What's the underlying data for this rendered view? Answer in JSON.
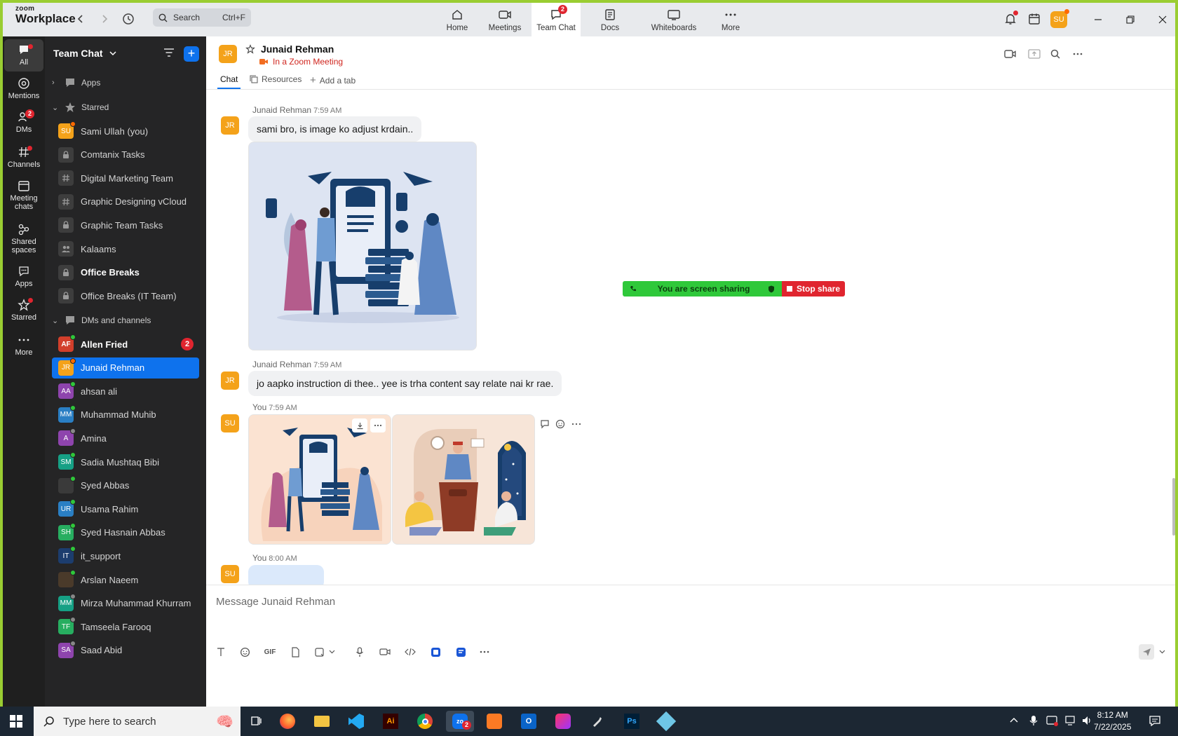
{
  "app": {
    "logo_small": "zoom",
    "logo_big": "Workplace",
    "search_placeholder": "Search",
    "search_shortcut": "Ctrl+F",
    "nav_tabs": [
      {
        "label": "Home"
      },
      {
        "label": "Meetings"
      },
      {
        "label": "Team Chat",
        "badge": "2"
      },
      {
        "label": "Docs"
      },
      {
        "label": "Whiteboards"
      },
      {
        "label": "More"
      }
    ],
    "user_initials": "SU"
  },
  "rail": {
    "items": [
      {
        "label": "All"
      },
      {
        "label": "Mentions"
      },
      {
        "label": "DMs",
        "badge": "2"
      },
      {
        "label": "Channels"
      },
      {
        "label": "Meeting chats"
      },
      {
        "label": "Shared spaces"
      },
      {
        "label": "Apps"
      },
      {
        "label": "Starred"
      },
      {
        "label": "More"
      }
    ]
  },
  "sidebar": {
    "title": "Team Chat",
    "apps_label": "Apps",
    "starred_label": "Starred",
    "dms_label": "DMs and channels",
    "starred": [
      {
        "name": "Sami Ullah (you)",
        "initials": "SU",
        "color": "#f4a21a",
        "status": "#ff6a00"
      },
      {
        "name": "Comtanix Tasks",
        "icon": "lock-icon"
      },
      {
        "name": "Digital Marketing Team",
        "icon": "hash-icon"
      },
      {
        "name": "Graphic Designing vCloud",
        "icon": "hash-icon"
      },
      {
        "name": "Graphic Team Tasks",
        "icon": "lock-icon"
      },
      {
        "name": "Kalaams",
        "icon": "group-icon"
      },
      {
        "name": "Office Breaks",
        "icon": "lock-icon",
        "bold": true
      },
      {
        "name": "Office Breaks (IT Team)",
        "icon": "lock-icon"
      }
    ],
    "dms": [
      {
        "name": "Allen Fried",
        "initials": "AF",
        "color": "#d23f2b",
        "status": "#2fc83a",
        "bold": true,
        "unread": "2"
      },
      {
        "name": "Junaid Rehman",
        "initials": "JR",
        "color": "#f4a21a",
        "status": "#ff6a00",
        "selected": true
      },
      {
        "name": "ahsan ali",
        "initials": "AA",
        "color": "#8e44ad",
        "status": "#2fc83a"
      },
      {
        "name": "Muhammad Muhib",
        "initials": "MM",
        "color": "#2a7fc4",
        "status": "#2fc83a"
      },
      {
        "name": "Amina",
        "initials": "A",
        "color": "#8e44ad",
        "status": "#888888"
      },
      {
        "name": "Sadia Mushtaq Bibi",
        "initials": "SM",
        "color": "#16a085",
        "status": "#2fc83a"
      },
      {
        "name": "Syed Abbas",
        "initials": "",
        "color": "#3a3a3a",
        "status": "#2fc83a"
      },
      {
        "name": "Usama Rahim",
        "initials": "UR",
        "color": "#2a7fc4",
        "status": "#2fc83a"
      },
      {
        "name": "Syed Hasnain Abbas",
        "initials": "SH",
        "color": "#27ae60",
        "status": "#2fc83a"
      },
      {
        "name": "it_support",
        "initials": "IT",
        "color": "#1c3d6e",
        "status": "#2fc83a"
      },
      {
        "name": "Arslan Naeem",
        "initials": "",
        "color": "#4a3a2a",
        "status": "#2fc83a"
      },
      {
        "name": "Mirza Muhammad Khurram",
        "initials": "MM",
        "color": "#16a085",
        "status": "#888888"
      },
      {
        "name": "Tamseela Farooq",
        "initials": "TF",
        "color": "#27ae60",
        "status": "#888888"
      },
      {
        "name": "Saad Abid",
        "initials": "SA",
        "color": "#8e44ad",
        "status": "#888888"
      }
    ]
  },
  "chat": {
    "name": "Junaid Rehman",
    "initials": "JR",
    "status": "In a Zoom Meeting",
    "tabs": [
      {
        "label": "Chat"
      },
      {
        "label": "Resources"
      },
      {
        "label": "Add a tab"
      }
    ],
    "messages": [
      {
        "sender": "Junaid Rehman",
        "time": "7:59 AM",
        "text": "sami bro, is image ko adjust krdain.."
      },
      {
        "sender": "Junaid Rehman",
        "time": "7:59 AM",
        "text": "jo aapko instruction di thee.. yee is trha content say relate nai kr rae."
      },
      {
        "sender": "You",
        "time": "7:59 AM"
      },
      {
        "sender": "You",
        "time": "8:00 AM"
      }
    ],
    "self_initials": "SU",
    "screen_share_text": "You are screen sharing",
    "stop_share_label": "Stop share",
    "composer_placeholder": "Message Junaid Rehman"
  },
  "taskbar": {
    "search_placeholder": "Type here to search",
    "time": "8:12 AM",
    "date": "7/22/2025",
    "zoom_badge": "2"
  },
  "colors": {
    "accent": "#0e72ed",
    "danger": "#e0252f",
    "success": "#2fc83a",
    "avatar_orange": "#f4a21a"
  }
}
